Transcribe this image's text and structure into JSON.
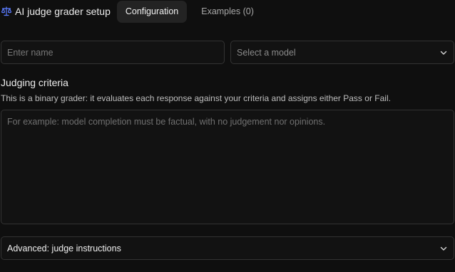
{
  "header": {
    "icon": "scale-icon",
    "title": "AI judge grader setup",
    "tabs": [
      {
        "label": "Configuration",
        "active": true
      },
      {
        "label": "Examples (0)",
        "active": false
      }
    ]
  },
  "form": {
    "name_placeholder": "Enter name",
    "name_value": "",
    "model_placeholder": "Select a model",
    "criteria_title": "Judging criteria",
    "criteria_description": "This is a binary grader: it evaluates each response against your criteria and assigns either Pass or Fail.",
    "criteria_placeholder": "For example: model completion must be factual, with no judgement nor opinions.",
    "advanced_label": "Advanced: judge instructions"
  },
  "colors": {
    "background": "#0f0f0f",
    "accent_icon": "#5b7cff",
    "border": "#333333"
  }
}
